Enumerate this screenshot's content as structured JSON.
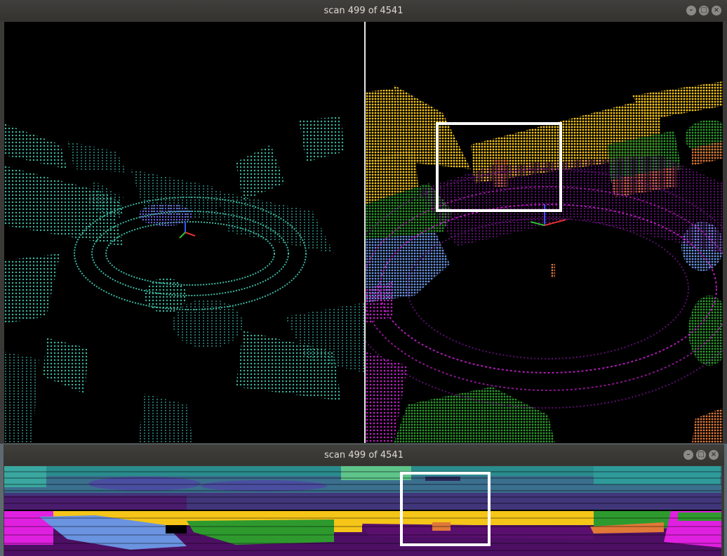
{
  "main_window": {
    "title": "scan 499 of 4541",
    "controls": {
      "minimize": "–",
      "maximize": "□",
      "close": "×"
    }
  },
  "range_window": {
    "title": "scan 499 of 4541",
    "controls": {
      "minimize": "–",
      "maximize": "□",
      "close": "×"
    }
  },
  "colors": {
    "remission_teal": "#3bb8a2",
    "label_yellow": "#f5c518",
    "label_magenta": "#c21ec9",
    "label_purple": "#5a0f6e",
    "label_green": "#2e9a2e",
    "label_blue": "#6a93e0",
    "label_orange": "#e07838",
    "selection_white": "#ffffff"
  }
}
